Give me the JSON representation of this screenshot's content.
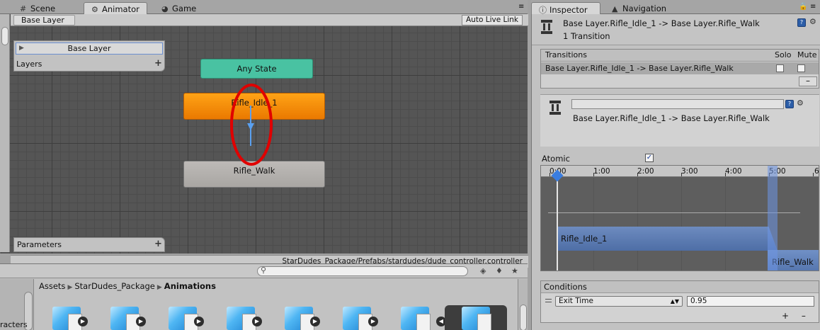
{
  "tabs_left": [
    {
      "label": "Scene",
      "icon": "hash-icon"
    },
    {
      "label": "Animator",
      "icon": "animator-icon",
      "active": true
    },
    {
      "label": "Game",
      "icon": "pacman-icon"
    }
  ],
  "tabs_right": [
    {
      "label": "Inspector",
      "icon": "info-icon",
      "active": true
    },
    {
      "label": "Navigation",
      "icon": "navigation-icon"
    }
  ],
  "animator": {
    "breadcrumb": "Base Layer",
    "auto_live_link": "Auto Live Link",
    "layers_header": "Layers",
    "layer_name": "Base Layer",
    "parameters_header": "Parameters",
    "controller_path": "StarDudes_Package/Prefabs/stardudes/dude_controller.controller",
    "states": {
      "any": "Any State",
      "idle": "Rifle_Idle_1",
      "walk": "Rifle_Walk"
    },
    "colors": {
      "any": "#49c2a2",
      "default_state": "#ff9a10",
      "state": "#b3b0ad",
      "transition": "#5aa0f0",
      "annotation": "#e00000"
    }
  },
  "project": {
    "breadcrumb": [
      "Assets",
      "StarDudes_Package",
      "Animations"
    ],
    "left_label": "racters",
    "asset_count": 8
  },
  "inspector": {
    "title": "Base Layer.Rifle_Idle_1 -> Base Layer.Rifle_Walk",
    "subtitle": "1 Transition",
    "transitions_header": "Transitions",
    "solo_label": "Solo",
    "mute_label": "Mute",
    "transition_row": "Base Layer.Rifle_Idle_1 -> Base Layer.Rifle_Walk",
    "minus": "–",
    "sub_title": "Base Layer.Rifle_Idle_1 -> Base Layer.Rifle_Walk",
    "atomic_label": "Atomic",
    "atomic_checked": true,
    "ruler": [
      "0:00",
      "1:00",
      "2:00",
      "3:00",
      "4:00",
      "5:00",
      "6"
    ],
    "clip_idle": "Rifle_Idle_1",
    "clip_walk": "Rifle_Walk",
    "conditions_header": "Conditions",
    "condition_param": "Exit Time",
    "condition_value": "0.95",
    "plus": "+",
    "minus2": "–"
  }
}
